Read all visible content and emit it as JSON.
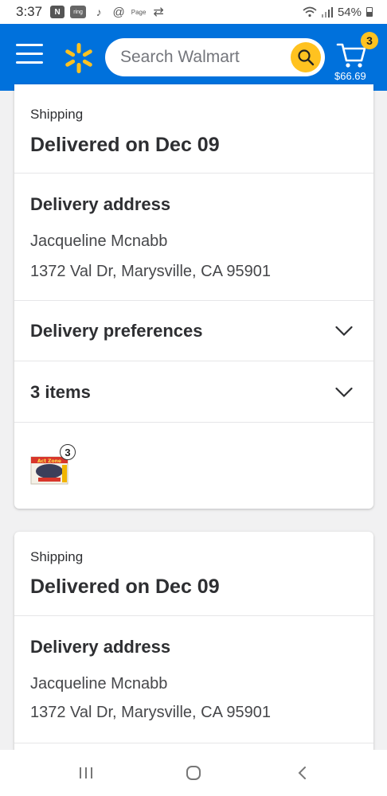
{
  "status_bar": {
    "time": "3:37",
    "battery": "54%",
    "icons": [
      "n-icon",
      "ring-icon",
      "tiktok-icon",
      "threads-icon",
      "page-plus-icon",
      "retweet-icon"
    ],
    "notif_labels": {
      "n": "N",
      "ring": "ring",
      "tiktok": "♪",
      "threads": "@",
      "page": "Page",
      "retweet": "⇄"
    }
  },
  "header": {
    "search_placeholder": "Search Walmart",
    "cart_count": "3",
    "cart_total": "$66.69",
    "brand_color": "#0071dc",
    "accent_color": "#ffc220"
  },
  "orders": [
    {
      "shipping_label": "Shipping",
      "delivery_status": "Delivered on Dec 09",
      "address_heading": "Delivery address",
      "recipient": "Jacqueline Mcnabb",
      "address": "1372 Val Dr, Marysville, CA 95901",
      "preferences_label": "Delivery preferences",
      "items_label": "3 items",
      "item_quantity": "3",
      "item_thumbnail_brand": "Act Zone"
    },
    {
      "shipping_label": "Shipping",
      "delivery_status": "Delivered on Dec 09",
      "address_heading": "Delivery address",
      "recipient": "Jacqueline Mcnabb",
      "address": "1372 Val Dr, Marysville, CA 95901"
    }
  ]
}
